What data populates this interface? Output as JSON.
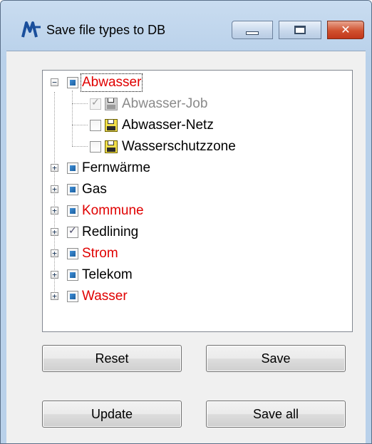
{
  "window": {
    "title": "Save file types to DB",
    "controls": {
      "minimize": "–",
      "maximize": "□",
      "close": "✕"
    }
  },
  "tree": {
    "items": [
      {
        "label": "Abwasser",
        "color": "red",
        "expanded": true,
        "state": "indeterminate",
        "focused": true,
        "children": [
          {
            "label": "Abwasser-Job",
            "checked": true,
            "disabled": true,
            "icon": "floppy-disk-icon"
          },
          {
            "label": "Abwasser-Netz",
            "checked": false,
            "disabled": false,
            "icon": "floppy-disk-icon"
          },
          {
            "label": "Wasserschutzzone",
            "checked": false,
            "disabled": false,
            "icon": "floppy-disk-icon"
          }
        ]
      },
      {
        "label": "Fernwärme",
        "color": "black",
        "expanded": false,
        "state": "indeterminate"
      },
      {
        "label": "Gas",
        "color": "black",
        "expanded": false,
        "state": "indeterminate"
      },
      {
        "label": "Kommune",
        "color": "red",
        "expanded": false,
        "state": "indeterminate"
      },
      {
        "label": "Redlining",
        "color": "black",
        "expanded": false,
        "state": "checked"
      },
      {
        "label": "Strom",
        "color": "red",
        "expanded": false,
        "state": "indeterminate"
      },
      {
        "label": "Telekom",
        "color": "black",
        "expanded": false,
        "state": "indeterminate"
      },
      {
        "label": "Wasser",
        "color": "red",
        "expanded": false,
        "state": "indeterminate"
      }
    ]
  },
  "buttons": {
    "reset": "Reset",
    "save": "Save",
    "update": "Update",
    "save_all": "Save all"
  },
  "colors": {
    "highlight_text": "#e00000",
    "window_frame": "#b9d1ea",
    "indeterminate_fill": "#1c5f9e"
  }
}
